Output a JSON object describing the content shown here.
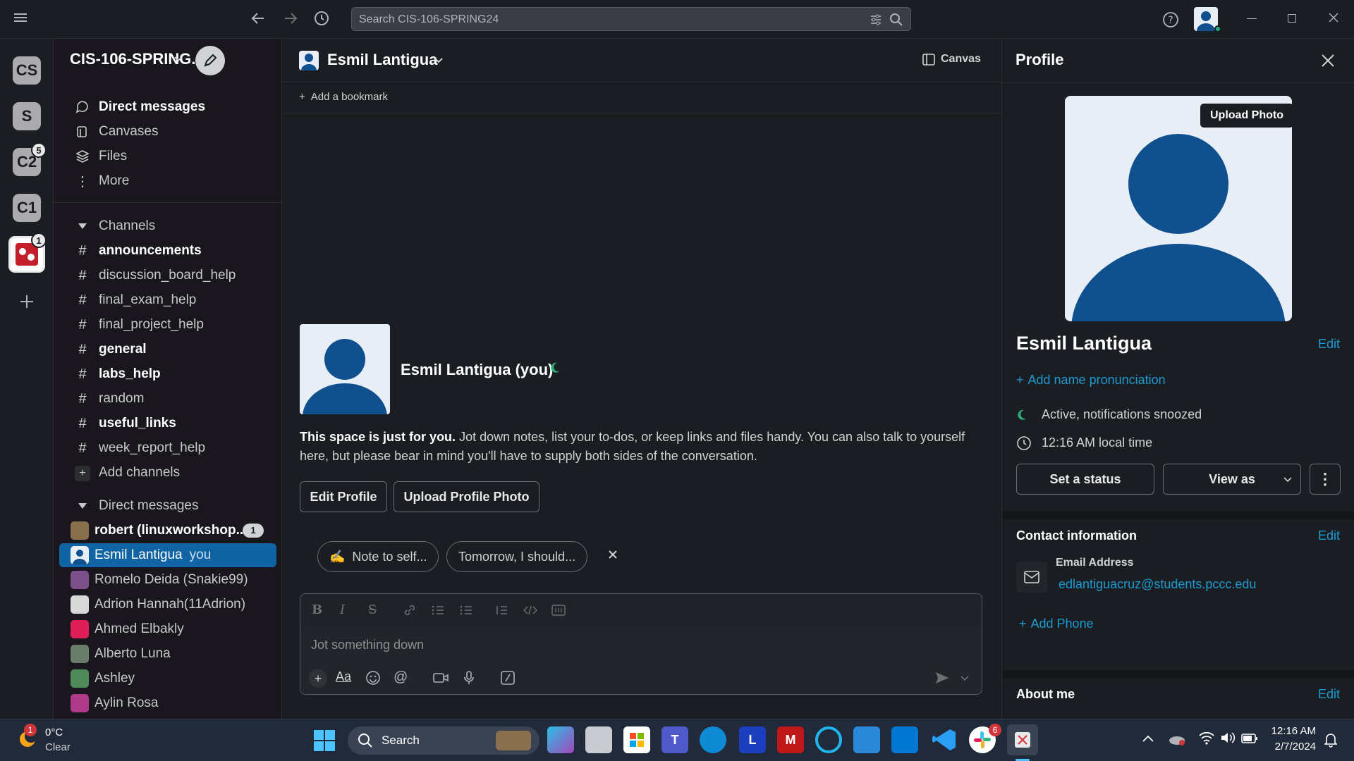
{
  "topbar": {
    "search_placeholder": "Search CIS-106-SPRING24"
  },
  "rail": {
    "workspaces": [
      {
        "label": "CS"
      },
      {
        "label": "S"
      },
      {
        "label": "C2",
        "badge": "5"
      },
      {
        "label": "C1"
      },
      {
        "label": "",
        "badge": "1"
      }
    ]
  },
  "sidebar": {
    "workspace_name": "CIS-106-SPRING...",
    "nav": [
      {
        "label": "Direct messages",
        "icon": "chat-bubble-icon"
      },
      {
        "label": "Canvases",
        "icon": "canvas-icon"
      },
      {
        "label": "Files",
        "icon": "files-icon"
      },
      {
        "label": "More",
        "icon": "more-vertical-icon"
      }
    ],
    "channels_header": "Channels",
    "channels": [
      {
        "name": "announcements",
        "bold": true
      },
      {
        "name": "discussion_board_help",
        "bold": false
      },
      {
        "name": "final_exam_help",
        "bold": false
      },
      {
        "name": "final_project_help",
        "bold": false
      },
      {
        "name": "general",
        "bold": true
      },
      {
        "name": "labs_help",
        "bold": true
      },
      {
        "name": "random",
        "bold": false
      },
      {
        "name": "useful_links",
        "bold": true
      },
      {
        "name": "week_report_help",
        "bold": false
      }
    ],
    "add_channels": "Add channels",
    "dm_header": "Direct messages",
    "dms": [
      {
        "name": "robert (linuxworkshop...",
        "badge": "1",
        "bold": true
      },
      {
        "name": "Esmil Lantigua",
        "suffix": "you",
        "selected": true
      },
      {
        "name": "Romelo Deida (Snakie99)"
      },
      {
        "name": "Adrion Hannah(11Adrion)"
      },
      {
        "name": "Ahmed Elbakly"
      },
      {
        "name": "Alberto Luna"
      },
      {
        "name": "Ashley"
      },
      {
        "name": "Aylin Rosa"
      }
    ]
  },
  "main": {
    "title": "Esmil Lantigua",
    "canvas_label": "Canvas",
    "bookmark_label": "Add a bookmark",
    "intro_name": "Esmil Lantigua (you)",
    "intro_bold": "This space is just for you.",
    "intro_text": " Jot down notes, list your to-dos, or keep links and files handy. You can also talk to yourself here, but please bear in mind you'll have to supply both sides of the conversation.",
    "edit_profile": "Edit Profile",
    "upload_profile_photo": "Upload Profile Photo",
    "suggestions": [
      {
        "emoji": "✍️",
        "label": "Note to self..."
      },
      {
        "label": "Tomorrow, I should..."
      }
    ],
    "composer_placeholder": "Jot something down"
  },
  "profile": {
    "header": "Profile",
    "upload_photo": "Upload Photo",
    "name": "Esmil Lantigua",
    "edit": "Edit",
    "add_pronunciation": "Add name pronunciation",
    "status": "Active, notifications snoozed",
    "local_time": "12:16 AM local time",
    "set_status": "Set a status",
    "view_as": "View as",
    "contact_header": "Contact information",
    "email_label": "Email Address",
    "email": "edlantiguacruz@students.pccc.edu",
    "add_phone": "Add Phone",
    "about_header": "About me",
    "avatar_color": "#10508f"
  },
  "taskbar": {
    "weather_temp": "0°C",
    "weather_desc": "Clear",
    "weather_badge": "1",
    "search_label": "Search",
    "slack_badge": "6",
    "time": "12:16 AM",
    "date": "2/7/2024"
  },
  "colors": {
    "accent_link": "#1d9bd1",
    "selected_row": "#1164a3",
    "presence_green": "#2bac76"
  }
}
